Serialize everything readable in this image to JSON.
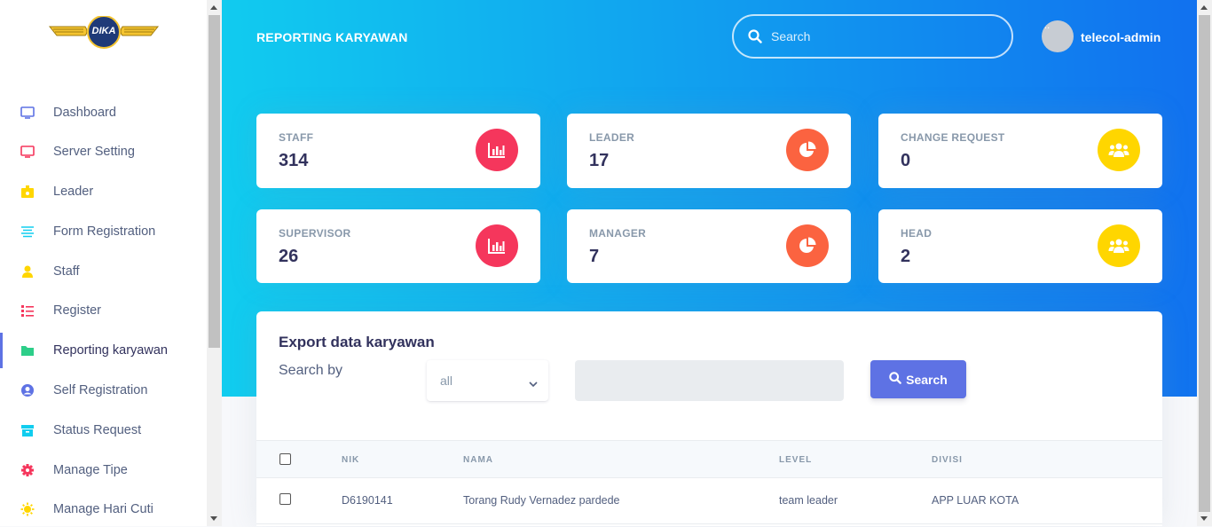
{
  "colors": {
    "primary": "#5e72e4",
    "gradient_start": "#11cdef",
    "gradient_end": "#1171ef",
    "red": "#f5365c",
    "orange": "#fb6340",
    "yellow": "#ffd600"
  },
  "brand": {
    "logo_text": "DIKA"
  },
  "sidebar": {
    "items": [
      {
        "label": "Dashboard",
        "icon": "monitor-icon"
      },
      {
        "label": "Server Setting",
        "icon": "tv-icon"
      },
      {
        "label": "Leader",
        "icon": "badge-icon"
      },
      {
        "label": "Form Registration",
        "icon": "align-left-icon"
      },
      {
        "label": "Staff",
        "icon": "user-icon"
      },
      {
        "label": "Register",
        "icon": "list-icon"
      },
      {
        "label": "Reporting karyawan",
        "icon": "folder-icon"
      },
      {
        "label": "Self Registration",
        "icon": "user-circle-icon"
      },
      {
        "label": "Status Request",
        "icon": "archive-icon"
      },
      {
        "label": "Manage Tipe",
        "icon": "gear-icon"
      },
      {
        "label": "Manage Hari Cuti",
        "icon": "sun-icon"
      }
    ],
    "active_index": 6
  },
  "header": {
    "title": "REPORTING KARYAWAN",
    "search_placeholder": "Search",
    "user_name": "telecol-admin",
    "avatar_alt": "..."
  },
  "stats": [
    {
      "title": "STAFF",
      "value": "314",
      "icon": "chart-bar-icon",
      "color": "#f5365c"
    },
    {
      "title": "LEADER",
      "value": "17",
      "icon": "chart-pie-icon",
      "color": "#fb6340"
    },
    {
      "title": "CHANGE REQUEST",
      "value": "0",
      "icon": "users-icon",
      "color": "#ffd600"
    },
    {
      "title": "SUPERVISOR",
      "value": "26",
      "icon": "chart-bar-icon",
      "color": "#f5365c"
    },
    {
      "title": "MANAGER",
      "value": "7",
      "icon": "chart-pie-icon",
      "color": "#fb6340"
    },
    {
      "title": "HEAD",
      "value": "2",
      "icon": "users-icon",
      "color": "#ffd600"
    }
  ],
  "export": {
    "title": "Export data karyawan",
    "search_by_label": "Search by",
    "select_value": "all",
    "text_value": "",
    "button_label": "Search"
  },
  "table": {
    "columns": [
      "NIK",
      "NAMA",
      "LEVEL",
      "DIVISI"
    ],
    "rows": [
      {
        "nik": "D6190141",
        "nama": "Torang Rudy Vernadez pardede",
        "level": "team leader",
        "divisi": "APP LUAR KOTA"
      }
    ]
  }
}
